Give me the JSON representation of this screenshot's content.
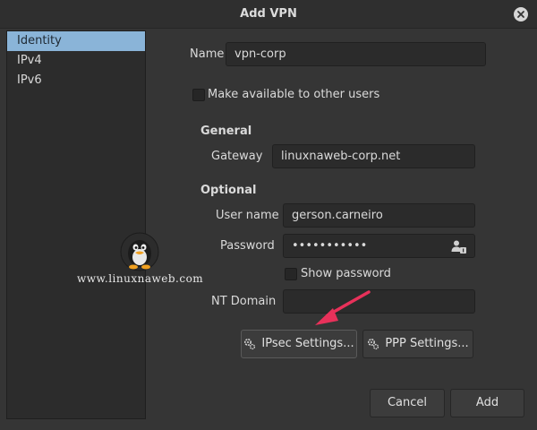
{
  "window": {
    "title": "Add VPN"
  },
  "sidebar": {
    "items": [
      {
        "label": "Identity",
        "selected": true
      },
      {
        "label": "IPv4",
        "selected": false
      },
      {
        "label": "IPv6",
        "selected": false
      }
    ]
  },
  "identity": {
    "name_label": "Name",
    "name_value": "vpn-corp",
    "share_label": "Make available to other users"
  },
  "general": {
    "heading": "General",
    "gateway_label": "Gateway",
    "gateway_value": "linuxnaweb-corp.net"
  },
  "optional": {
    "heading": "Optional",
    "username_label": "User name",
    "username_value": "gerson.carneiro",
    "password_label": "Password",
    "password_value": "•••••••••••",
    "show_password_label": "Show password",
    "nt_domain_label": "NT Domain",
    "nt_domain_value": ""
  },
  "buttons": {
    "ipsec": "IPsec Settings...",
    "ppp": "PPP Settings...",
    "cancel": "Cancel",
    "add": "Add"
  },
  "watermark": {
    "text": "www.linuxnaweb.com"
  },
  "colors": {
    "background": "#353535",
    "selection": "#8ab4d8",
    "annotation_arrow": "#e8315a"
  }
}
